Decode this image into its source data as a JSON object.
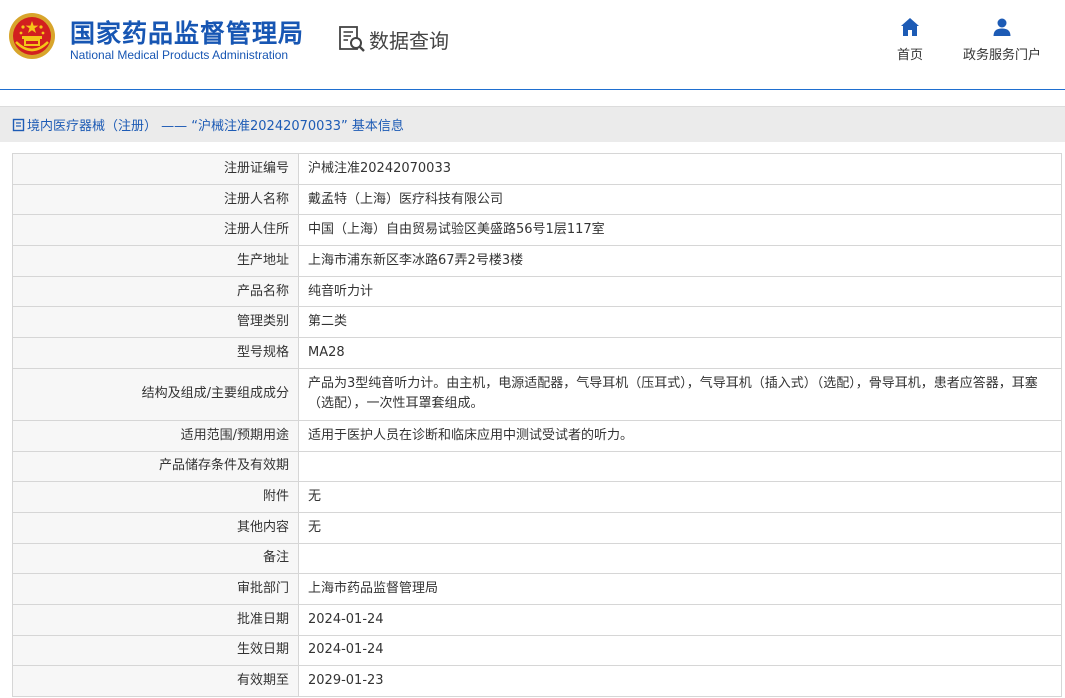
{
  "header": {
    "title_cn": "国家药品监督管理局",
    "title_en": "National Medical Products Administration",
    "query_label": "数据查询",
    "nav": {
      "home": "首页",
      "portal": "政务服务门户"
    }
  },
  "breadcrumb": {
    "text": "境内医疗器械（注册） —— “沪械注准20242070033” 基本信息"
  },
  "colors": {
    "brand_blue": "#1756b3",
    "header_line": "#1f6fd0",
    "crumb_bg": "#ebebeb"
  },
  "icons": [
    "national-emblem-icon",
    "data-query-icon",
    "home-icon",
    "user-icon",
    "document-icon"
  ],
  "details": [
    {
      "label": "注册证编号",
      "value": "沪械注准20242070033"
    },
    {
      "label": "注册人名称",
      "value": "戴孟特（上海）医疗科技有限公司"
    },
    {
      "label": "注册人住所",
      "value": "中国（上海）自由贸易试验区美盛路56号1层117室"
    },
    {
      "label": "生产地址",
      "value": "上海市浦东新区李冰路67弄2号楼3楼"
    },
    {
      "label": "产品名称",
      "value": "纯音听力计"
    },
    {
      "label": "管理类别",
      "value": "第二类"
    },
    {
      "label": "型号规格",
      "value": "MA28"
    },
    {
      "label": "结构及组成/主要组成成分",
      "value": "产品为3型纯音听力计。由主机，电源适配器，气导耳机（压耳式），气导耳机（插入式）（选配），骨导耳机，患者应答器，耳塞（选配），一次性耳罩套组成。"
    },
    {
      "label": "适用范围/预期用途",
      "value": "适用于医护人员在诊断和临床应用中测试受试者的听力。"
    },
    {
      "label": "产品储存条件及有效期",
      "value": ""
    },
    {
      "label": "附件",
      "value": "无"
    },
    {
      "label": "其他内容",
      "value": "无"
    },
    {
      "label": "备注",
      "value": ""
    },
    {
      "label": "审批部门",
      "value": "上海市药品监督管理局"
    },
    {
      "label": "批准日期",
      "value": "2024-01-24"
    },
    {
      "label": "生效日期",
      "value": "2024-01-24"
    },
    {
      "label": "有效期至",
      "value": "2029-01-23"
    }
  ]
}
